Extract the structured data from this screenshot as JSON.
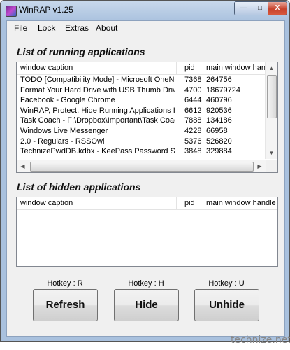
{
  "window": {
    "title": "WinRAP v1.25",
    "controls": {
      "minimize": "—",
      "maximize": "□",
      "close": "X"
    }
  },
  "menu": [
    "File",
    "Lock",
    "Extras",
    "About"
  ],
  "running": {
    "title": "List of running applications",
    "columns": [
      "window caption",
      "pid",
      "main window handle"
    ],
    "rows": [
      [
        "TODO [Compatibility Mode] - Microsoft OneNote",
        "7368",
        "264756"
      ],
      [
        "Format Your Hard Drive with USB Thumb Drive - ...",
        "4700",
        "18679724"
      ],
      [
        "Facebook - Google Chrome",
        "6444",
        "460796"
      ],
      [
        "WinRAP, Protect, Hide Running Applications In W...",
        "6612",
        "920536"
      ],
      [
        "Task Coach - F:\\Dropbox\\Important\\Task Coach ...",
        "7888",
        "134186"
      ],
      [
        "Windows Live Messenger",
        "4228",
        "66958"
      ],
      [
        "2.0 - Regulars - RSSOwl",
        "5376",
        "526820"
      ],
      [
        "TechnizePwdDB.kdbx - KeePass Password Safe",
        "3848",
        "329884"
      ]
    ]
  },
  "hidden": {
    "title": "List of hidden applications",
    "columns": [
      "window caption",
      "pid",
      "main window handle"
    ],
    "rows": []
  },
  "buttons": [
    {
      "hotkey": "Hotkey : R",
      "label": "Refresh"
    },
    {
      "hotkey": "Hotkey : H",
      "label": "Hide"
    },
    {
      "hotkey": "Hotkey : U",
      "label": "Unhide"
    }
  ],
  "watermark": "technize.net"
}
